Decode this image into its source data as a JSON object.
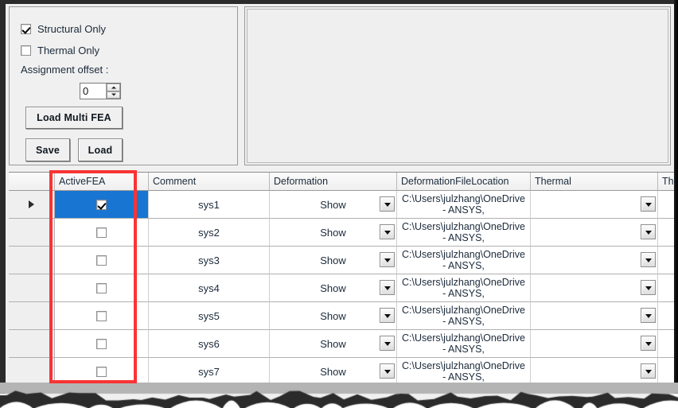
{
  "panel": {
    "structural_only": {
      "label": "Structural Only",
      "checked": true,
      "icon": "checkbox-checked-icon"
    },
    "thermal_only": {
      "label": "Thermal Only",
      "checked": false,
      "icon": "checkbox-unchecked-icon"
    },
    "assignment_offset_label": "Assignment offset :",
    "offset_value": "0",
    "spinner_up_icon": "spinner-up-arrow-icon",
    "spinner_down_icon": "spinner-down-arrow-icon",
    "buttons": {
      "load_multi_fea": "Load Multi FEA",
      "save": "Save",
      "load": "Load"
    }
  },
  "grid": {
    "columns": [
      {
        "key": "gutter",
        "label": ""
      },
      {
        "key": "active",
        "label": "ActiveFEA"
      },
      {
        "key": "comment",
        "label": "Comment"
      },
      {
        "key": "deformation",
        "label": "Deformation"
      },
      {
        "key": "defloc",
        "label": "DeformationFileLocation"
      },
      {
        "key": "thermal",
        "label": "Thermal"
      },
      {
        "key": "thermal2",
        "label": "Them"
      }
    ],
    "path_line1": "C:\\Users\\julzhang\\OneDrive",
    "path_line2": "- ANSYS,",
    "dropdown_icon": "chevron-down-icon",
    "row_pointer_icon": "row-selector-triangle-icon",
    "rows": [
      {
        "active": true,
        "comment": "sys1",
        "deformation": "Show",
        "thermal": "",
        "selected": true
      },
      {
        "active": false,
        "comment": "sys2",
        "deformation": "Show",
        "thermal": "",
        "selected": false
      },
      {
        "active": false,
        "comment": "sys3",
        "deformation": "Show",
        "thermal": "",
        "selected": false
      },
      {
        "active": false,
        "comment": "sys4",
        "deformation": "Show",
        "thermal": "",
        "selected": false
      },
      {
        "active": false,
        "comment": "sys5",
        "deformation": "Show",
        "thermal": "",
        "selected": false
      },
      {
        "active": false,
        "comment": "sys6",
        "deformation": "Show",
        "thermal": "",
        "selected": false
      },
      {
        "active": false,
        "comment": "sys7",
        "deformation": "Show",
        "thermal": "",
        "selected": false
      }
    ]
  },
  "annotation": {
    "highlight_color": "#f83434",
    "target_column": "ActiveFEA"
  },
  "colors": {
    "selection": "#1876d2",
    "surface": "#f0f0f0",
    "grid_line": "#b0b0b0"
  }
}
